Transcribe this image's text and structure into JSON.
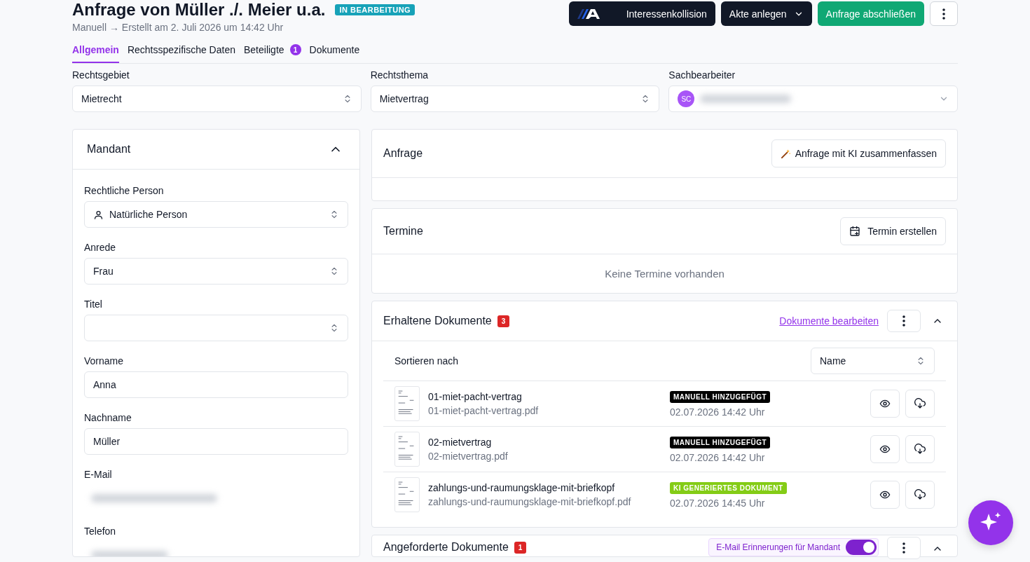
{
  "header": {
    "title": "Anfrage von Müller ./. Meier u.a.",
    "status_badge": "IN BEARBEITUNG",
    "subtitle": "Manuell → Erstellt am 2. Juli 2026 um 14:42 Uhr",
    "actions": [
      {
        "kind": "logo",
        "label": "Interessenkollision"
      },
      {
        "kind": "dropdown",
        "label": "Akte anlegen"
      },
      {
        "kind": "primary",
        "label": "Anfrage abschließen"
      },
      {
        "kind": "more"
      }
    ]
  },
  "tabs": [
    {
      "label": "Allgemein",
      "selected": true
    },
    {
      "label": "Rechtsspezifische Daten",
      "selected": false
    },
    {
      "label": "Beteiligte",
      "badge": "1",
      "selected": false
    },
    {
      "label": "Dokumente",
      "selected": false
    }
  ],
  "top_fields": [
    {
      "label": "Rechtsgebiet",
      "kind": "select",
      "value": "Mietrecht"
    },
    {
      "label": "Rechtsthema",
      "kind": "select",
      "value": "Mietvertrag"
    },
    {
      "label": "Sachbearbeiter",
      "kind": "user",
      "avatar": "SC"
    }
  ],
  "mandant": {
    "title": "Mandant",
    "expanded": true,
    "fields": [
      {
        "label": "Rechtliche Person",
        "kind": "personselect",
        "value": "Natürliche Person"
      },
      {
        "label": "Anrede",
        "kind": "select",
        "value": "Frau"
      },
      {
        "label": "Titel",
        "kind": "select"
      },
      {
        "label": "Vorname",
        "kind": "text",
        "value": "Anna"
      },
      {
        "label": "Nachname",
        "kind": "text",
        "value": "Müller"
      },
      {
        "label": "E-Mail",
        "kind": "blurred"
      },
      {
        "label": "Telefon",
        "kind": "blurred"
      }
    ]
  },
  "anfrage": {
    "title": "Anfrage",
    "button": "Anfrage mit KI zusammenfassen"
  },
  "termine": {
    "title": "Termine",
    "button": "Termin erstellen",
    "empty": "Keine Termine vorhanden"
  },
  "documents": {
    "title": "Erhaltene Dokumente",
    "count": "3",
    "link": "Dokumente bearbeiten",
    "expanded": true,
    "sort_label": "Sortieren nach",
    "sort_value": "Name",
    "rows": [
      {
        "name": "01-miet-pacht-vertrag",
        "file": "01-miet-pacht-vertrag.pdf",
        "tag": "MANUELL HINZUGEFÜGT",
        "color": "#000000",
        "date": "02.07.2026 14:42 Uhr"
      },
      {
        "name": "02-mietvertrag",
        "file": "02-mietvertrag.pdf",
        "tag": "MANUELL HINZUGEFÜGT",
        "color": "#000000",
        "date": "02.07.2026 14:42 Uhr"
      },
      {
        "name": "zahlungs-und-raumungsklage-mit-briefkopf",
        "file": "zahlungs-und-raumungsklage-mit-briefkopf.pdf",
        "tag": "KI GENERIERTES DOKUMENT",
        "color": "#84cc16",
        "date": "02.07.2026 14:45 Uhr"
      }
    ]
  },
  "requested": {
    "title": "Angeforderte Dokumente",
    "count": "1",
    "toggle_label": "E-Mail Erinnerungen für Mandant",
    "toggle_on": true
  }
}
